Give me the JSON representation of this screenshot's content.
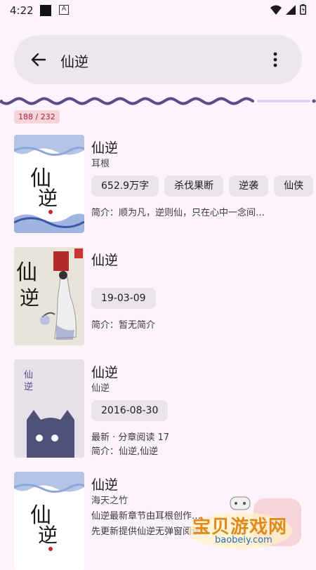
{
  "status": {
    "time": "4:22",
    "a_badge": "A"
  },
  "search": {
    "query": "仙逆"
  },
  "results": {
    "count": "188 / 232",
    "progress": 0.8
  },
  "books": [
    {
      "title": "仙逆",
      "author": "耳根",
      "tags": [
        "652.9万字",
        "杀伐果断",
        "逆袭",
        "仙侠"
      ],
      "lines": [
        "简介：顺为凡，逆则仙，只在心中一念间…"
      ],
      "cover_text": "仙逆"
    },
    {
      "title": "仙逆",
      "author": "",
      "tags": [
        "19-03-09"
      ],
      "lines": [
        "简介：暂无简介"
      ],
      "cover_text": "仙逆"
    },
    {
      "title": "仙逆",
      "author": "仙逆",
      "tags": [
        "2016-08-30"
      ],
      "lines": [
        "最新 · 分章阅读 17",
        "简介：仙逆,仙逆"
      ],
      "cover_text": "仙逆"
    },
    {
      "title": "仙逆",
      "author": "海天之竹",
      "tags": [],
      "lines": [
        "仙逆最新章节由耳根创作…",
        "先更新提供仙逆无弹窗阅读…"
      ],
      "cover_text": "仙逆"
    }
  ],
  "watermark": {
    "text": "宝贝游戏网",
    "url": "baobeiy.com"
  },
  "colors": {
    "accent": "#5b4a8c",
    "chip_bg": "#ece4ec",
    "count_bg": "#f6d4d9",
    "count_fg": "#b01f36"
  }
}
